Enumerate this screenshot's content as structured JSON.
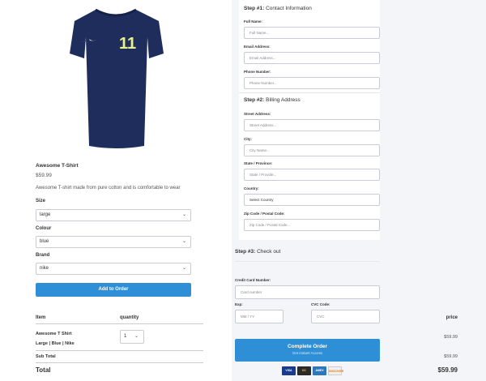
{
  "product": {
    "name": "Awesome T-Shirt",
    "price": "$59.99",
    "description": "Awesome T-shirt made from pure cotton and is comfortable to wear",
    "jersey_number": "11",
    "colors": {
      "shirt": "#1f2d5c",
      "number": "#e7f08a"
    }
  },
  "options": {
    "size": {
      "label": "Size",
      "value": "large"
    },
    "colour": {
      "label": "Colour",
      "value": "blue"
    },
    "brand": {
      "label": "Brand",
      "value": "nike"
    }
  },
  "add_to_order_label": "Add to Order",
  "table": {
    "headers": {
      "item": "Item",
      "quantity": "quantity",
      "price": "price"
    },
    "item_name": "Awesome T Shirt",
    "item_variant": "Large | Blue | Nike",
    "quantity": "1",
    "item_price": "$59.99",
    "subtotal_label": "Sub Total",
    "subtotal_value": "$59.99",
    "total_label": "Total",
    "total_value": "$59.99"
  },
  "step1": {
    "prefix": "Step #1:",
    "title": "Contact Information",
    "fields": [
      {
        "label": "Full Name:",
        "placeholder": "Full Name..."
      },
      {
        "label": "Email Address:",
        "placeholder": "Email Address..."
      },
      {
        "label": "Phone Number:",
        "placeholder": "Phone Number..."
      }
    ]
  },
  "step2": {
    "prefix": "Step #2:",
    "title": "Billing Address",
    "fields": [
      {
        "label": "Street Address:",
        "placeholder": "Street Address..."
      },
      {
        "label": "City:",
        "placeholder": "City Name..."
      },
      {
        "label": "State / Province:",
        "placeholder": "State / Provide..."
      },
      {
        "label": "Country:",
        "placeholder": "Select Country"
      },
      {
        "label": "Zip Code / Postal Code:",
        "placeholder": "Zip Code / Postal Code..."
      }
    ]
  },
  "step3": {
    "prefix": "Step #3:",
    "title": "Check out",
    "card_label": "Credit Card Number:",
    "card_placeholder": "Card number",
    "exp_label": "Exp:",
    "exp_placeholder": "MM / YY",
    "cvc_label": "CVC Code:",
    "cvc_placeholder": "CVC"
  },
  "complete": {
    "label": "Complete Order",
    "sublabel": "Get instant Access"
  },
  "payment_cards": [
    "VISA",
    "MC",
    "AMEX",
    "DISCOVER"
  ],
  "accent_color": "#2e8fd6"
}
